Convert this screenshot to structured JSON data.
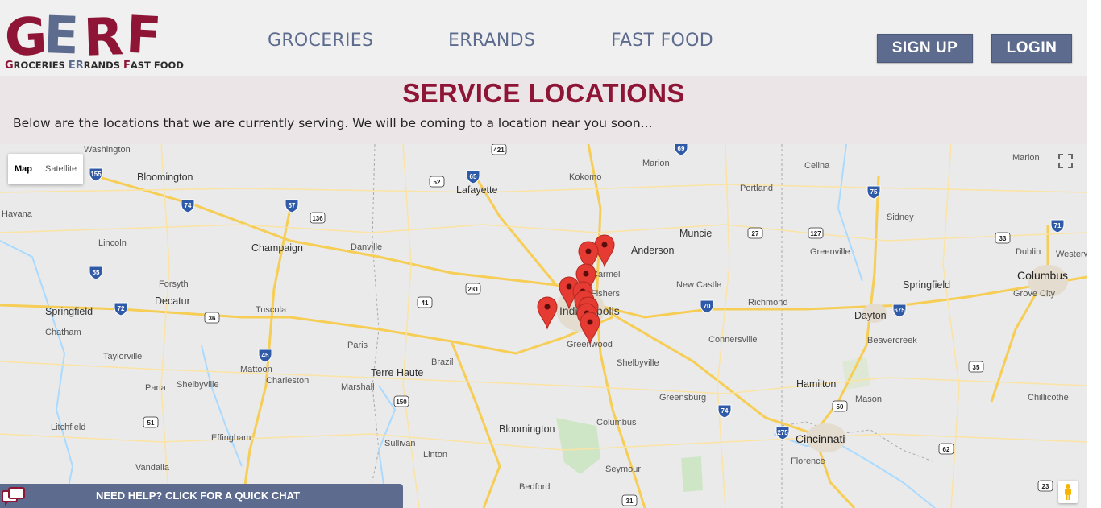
{
  "header": {
    "logo_letters": "GERF",
    "logo_tagline": {
      "p1": "G",
      "p2": "ROCERIES ",
      "p3": "ER",
      "p4": "RANDS ",
      "p5": "F",
      "p6": "AST FOOD"
    },
    "nav": {
      "groceries": "GROCERIES",
      "errands": "ERRANDS",
      "fast_food": "FAST FOOD"
    },
    "signup_label": "SIGN UP",
    "login_label": "LOGIN"
  },
  "banner": {
    "title": "SERVICE LOCATIONS",
    "subtitle": "Below are the locations that we are currently serving. We will be coming to a location near you soon..."
  },
  "map": {
    "type_map": "Map",
    "type_satellite": "Satellite",
    "cities": [
      "Washington",
      "Bloomington",
      "Kokomo",
      "Marion",
      "Celina",
      "Marion",
      "Havana",
      "Lafayette",
      "Portland",
      "Sidney",
      "Lincoln",
      "Champaign",
      "Danville",
      "Muncie",
      "Anderson",
      "Greenville",
      "Dublin",
      "Westerville",
      "Columbus",
      "Grove City",
      "Carmel",
      "Fishers",
      "New Castle",
      "Springfield",
      "Forsyth",
      "Decatur",
      "Springfield",
      "Tuscola",
      "Indianapolis",
      "Richmond",
      "Dayton",
      "Chatham",
      "Taylorville",
      "Paris",
      "Brazil",
      "Greenwood",
      "Connersville",
      "Beavercreek",
      "Pana",
      "Shelbyville",
      "Mattoon",
      "Charleston",
      "Terre Haute",
      "Marshall",
      "Shelbyville",
      "Hamilton",
      "Mason",
      "Chillicothe",
      "Greensburg",
      "Columbus",
      "Bloomington",
      "Litchfield",
      "Effingham",
      "Sullivan",
      "Cincinnati",
      "Florence",
      "Linton",
      "Seymour",
      "Vandalia",
      "Bedford"
    ],
    "highways": [
      "155",
      "74",
      "57",
      "136",
      "52",
      "65",
      "421",
      "69",
      "75",
      "127",
      "33",
      "71",
      "55",
      "72",
      "36",
      "231",
      "41",
      "27",
      "70",
      "675",
      "150",
      "45",
      "51",
      "74",
      "275",
      "62",
      "35",
      "50",
      "31",
      "23"
    ],
    "pin_color": "#e53b32",
    "water_color": "#aadaff",
    "road_color": "#f8d56a"
  },
  "chat": {
    "label": "NEED HELP? CLICK FOR A QUICK CHAT"
  },
  "colors": {
    "brand_red": "#8e1535",
    "brand_blue": "#5d6b8f",
    "nav_text": "#5c6b8e"
  }
}
